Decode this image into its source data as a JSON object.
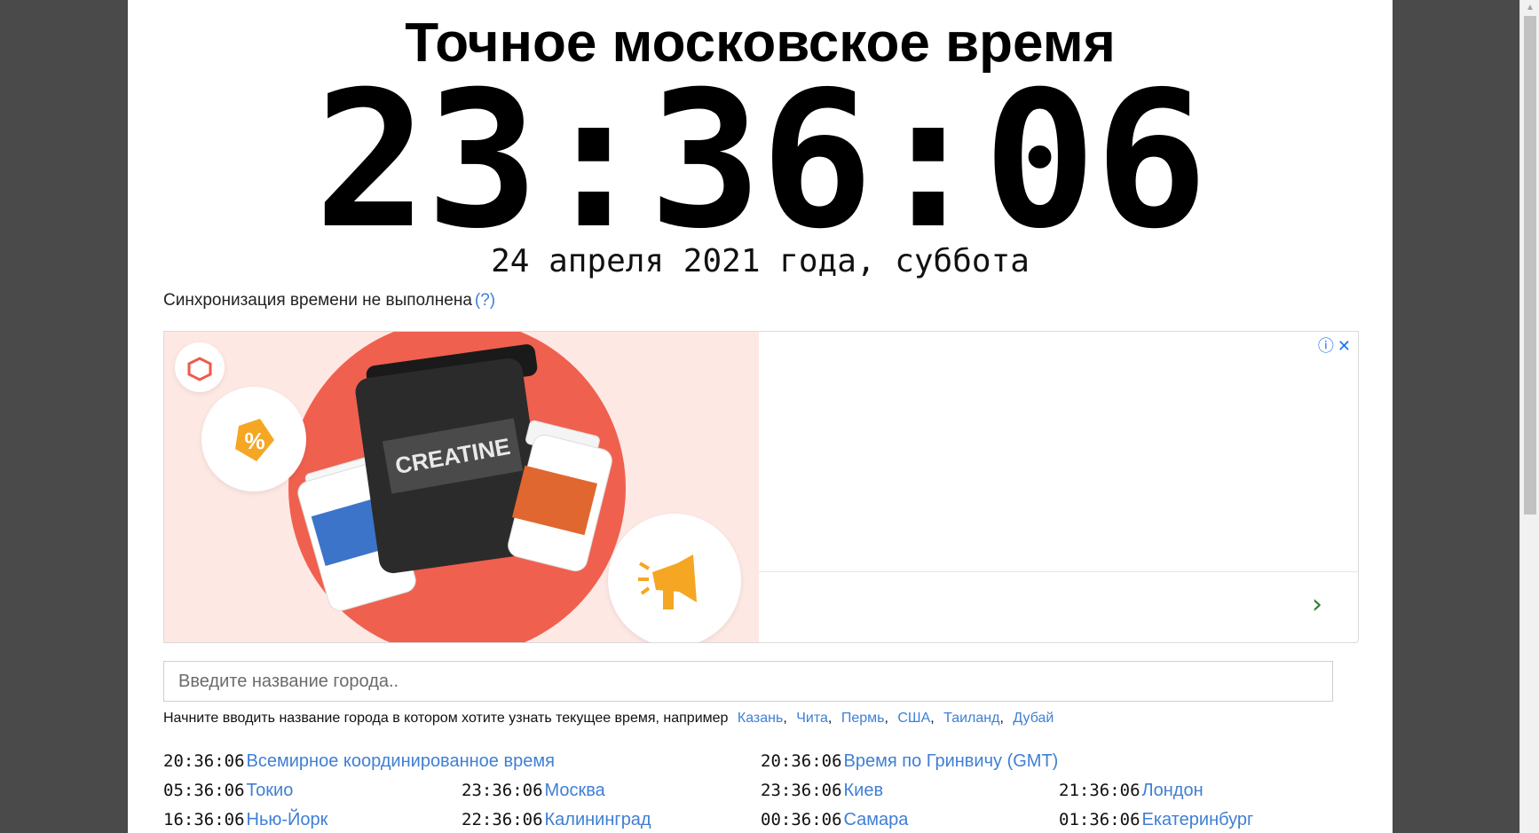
{
  "header": {
    "title": "Точное московское время",
    "clock": "23:36:06",
    "date": "24 апреля 2021 года, суббота"
  },
  "sync": {
    "status": "Синхронизация времени не выполнена",
    "help": "(?)"
  },
  "ad": {
    "info_icon": "info-icon",
    "close_icon": "close-icon",
    "arrow_icon": "chevron-right-icon",
    "product_label": "CREATINE",
    "colors": {
      "circle": "#f0604f",
      "background": "#fde8e3"
    }
  },
  "search": {
    "placeholder": "Введите название города.."
  },
  "hint": {
    "text": "Начните вводить название города в котором хотите узнать текущее время, например",
    "examples": [
      "Казань",
      "Чита",
      "Пермь",
      "США",
      "Таиланд",
      "Дубай"
    ]
  },
  "cities": [
    {
      "time": "20:36:06",
      "name": "Всемирное координированное время"
    },
    {
      "time": "20:36:06",
      "name": "Время по Гринвичу (GMT)"
    },
    {
      "time": "05:36:06",
      "name": "Токио"
    },
    {
      "time": "23:36:06",
      "name": "Москва"
    },
    {
      "time": "23:36:06",
      "name": "Киев"
    },
    {
      "time": "21:36:06",
      "name": "Лондон"
    },
    {
      "time": "16:36:06",
      "name": "Нью-Йорк"
    },
    {
      "time": "22:36:06",
      "name": "Калининград"
    },
    {
      "time": "00:36:06",
      "name": "Самара"
    },
    {
      "time": "01:36:06",
      "name": "Екатеринбург"
    }
  ]
}
